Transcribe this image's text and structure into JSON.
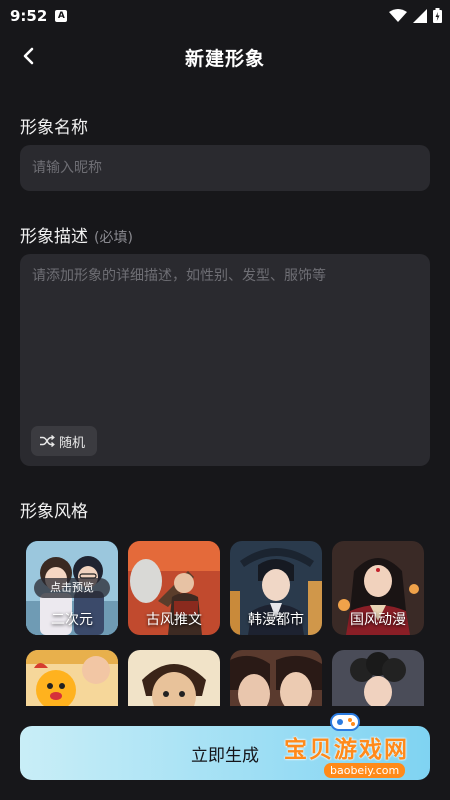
{
  "status": {
    "time": "9:52",
    "a_badge": "A"
  },
  "header": {
    "title": "新建形象"
  },
  "name_section": {
    "label": "形象名称",
    "placeholder": "请输入昵称",
    "value": ""
  },
  "desc_section": {
    "label": "形象描述",
    "required_hint": "(必填)",
    "placeholder": "请添加形象的详细描述，如性别、发型、服饰等",
    "value": "",
    "random_label": "随机"
  },
  "style_section": {
    "label": "形象风格",
    "selected_index": 0,
    "preview_label": "点击预览",
    "items": [
      {
        "label": "二次元",
        "icon": "anime-couple-art"
      },
      {
        "label": "古风推文",
        "icon": "ancient-warrior-art"
      },
      {
        "label": "韩漫都市",
        "icon": "korean-comic-city-art"
      },
      {
        "label": "国风动漫",
        "icon": "chinese-style-anime-art"
      },
      {
        "label": "",
        "icon": "cartoon-kids-art"
      },
      {
        "label": "",
        "icon": "shonen-boy-art"
      },
      {
        "label": "",
        "icon": "couple-faces-art"
      },
      {
        "label": "",
        "icon": "curly-hair-art"
      }
    ]
  },
  "footer": {
    "generate_label": "立即生成"
  },
  "watermark": {
    "text": "宝贝游戏网",
    "url": "baobeiy.com"
  },
  "colors": {
    "background": "#17171a",
    "accent": "#3aa6e8",
    "button_gradient": [
      "#c9eef7",
      "#7fd3f2"
    ]
  }
}
